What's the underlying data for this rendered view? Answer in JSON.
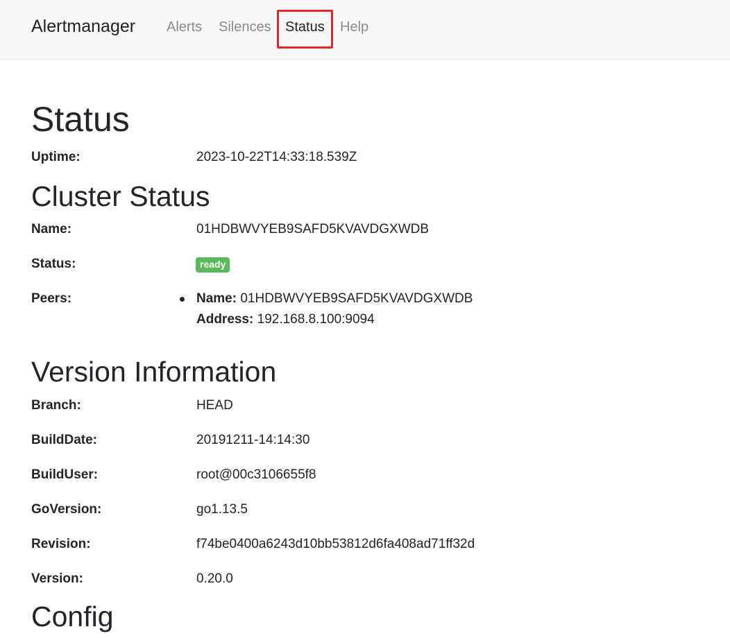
{
  "navbar": {
    "brand": "Alertmanager",
    "links": [
      {
        "label": "Alerts"
      },
      {
        "label": "Silences"
      },
      {
        "label": "Status"
      },
      {
        "label": "Help"
      }
    ]
  },
  "status": {
    "title": "Status",
    "uptime_label": "Uptime:",
    "uptime_value": "2023-10-22T14:33:18.539Z"
  },
  "cluster": {
    "title": "Cluster Status",
    "name_label": "Name:",
    "name_value": "01HDBWVYEB9SAFD5KVAVDGXWDB",
    "status_label": "Status:",
    "status_badge": "ready",
    "peers_label": "Peers:",
    "peer": {
      "name_label": "Name:",
      "name_value": "01HDBWVYEB9SAFD5KVAVDGXWDB",
      "address_label": "Address:",
      "address_value": "192.168.8.100:9094"
    }
  },
  "version": {
    "title": "Version Information",
    "rows": [
      {
        "label": "Branch:",
        "value": "HEAD"
      },
      {
        "label": "BuildDate:",
        "value": "20191211-14:14:30"
      },
      {
        "label": "BuildUser:",
        "value": "root@00c3106655f8"
      },
      {
        "label": "GoVersion:",
        "value": "go1.13.5"
      },
      {
        "label": "Revision:",
        "value": "f74be0400a6243d10bb53812d6fa408ad71ff32d"
      },
      {
        "label": "Version:",
        "value": "0.20.0"
      }
    ]
  },
  "config": {
    "title": "Config"
  },
  "colors": {
    "navbar_bg": "#f8f8f8",
    "badge_success": "#5cb85c",
    "highlight": "#e8222a"
  }
}
